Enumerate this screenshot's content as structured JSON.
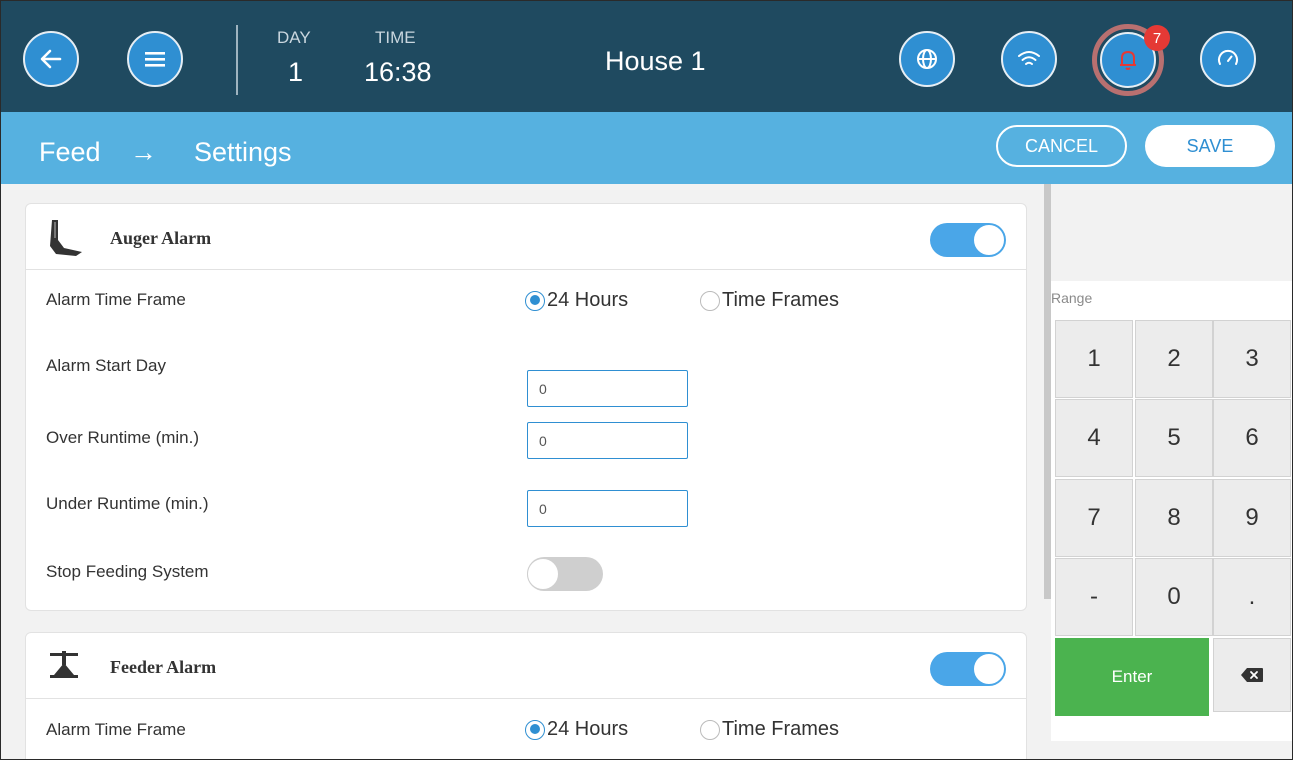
{
  "header": {
    "day_label": "DAY",
    "day_value": "1",
    "time_label": "TIME",
    "time_value": "16:38",
    "house": "House 1",
    "alarm_count": "7",
    "icons": [
      "back-arrow-icon",
      "menu-icon",
      "globe-icon",
      "wifi-icon",
      "bell-icon",
      "gauge-icon"
    ]
  },
  "breadcrumb": {
    "section": "Feed",
    "separator": "→",
    "page": "Settings",
    "cancel_label": "CANCEL",
    "save_label": "SAVE"
  },
  "auger": {
    "title": "Auger Alarm",
    "enabled": true,
    "time_frame_label": "Alarm Time Frame",
    "option_24h": "24 Hours",
    "option_frames": "Time Frames",
    "selected": "24 Hours",
    "start_day_label": "Alarm Start Day",
    "start_day_value": "0",
    "over_label": "Over Runtime (min.)",
    "over_value": "0",
    "under_label": "Under Runtime (min.)",
    "under_value": "0",
    "stop_label": "Stop Feeding System",
    "stop_enabled": false
  },
  "feeder": {
    "title": "Feeder Alarm",
    "enabled": true,
    "time_frame_label": "Alarm Time Frame",
    "option_24h": "24 Hours",
    "option_frames": "Time Frames",
    "selected": "24 Hours"
  },
  "keypad": {
    "range_label": "Range",
    "keys": [
      "1",
      "2",
      "3",
      "4",
      "5",
      "6",
      "7",
      "8",
      "9",
      "-",
      "0",
      "."
    ],
    "enter_label": "Enter"
  },
  "colors": {
    "topbar": "#1f4a60",
    "accent": "#2f8fd2",
    "crumbbar": "#56b1e0",
    "enter": "#4bb34f",
    "badge": "#e53935"
  }
}
